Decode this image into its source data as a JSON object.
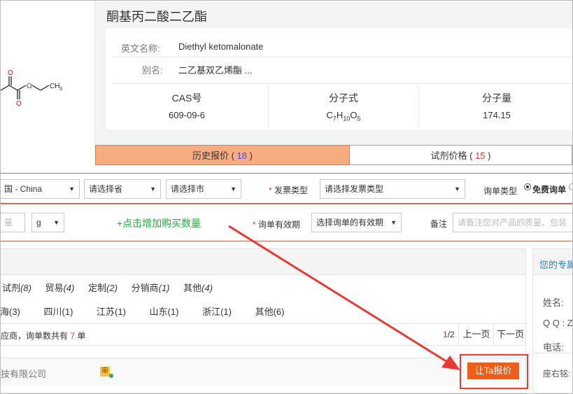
{
  "structure": {
    "o_top": "O",
    "o_mid": "O",
    "o_bottom": "O",
    "ch3": "CH",
    "ch3_sub": "3"
  },
  "compound": {
    "name_cn": "酮基丙二酸二乙酯",
    "english_label": "英文名称:",
    "english_name": "Diethyl ketomalonate",
    "alias_label": "别名:",
    "alias": "二乙基双乙烯酯 ...",
    "cas_label": "CAS号",
    "cas": "609-09-6",
    "formula_label": "分子式",
    "formula": {
      "c": "C",
      "c_n": "7",
      "h": "H",
      "h_n": "10",
      "o": "O",
      "o_n": "5"
    },
    "mw_label": "分子量",
    "mw": "174.15"
  },
  "tabs": [
    {
      "label": "历史报价",
      "count": "18"
    },
    {
      "label": "试剂价格",
      "count": "15"
    }
  ],
  "tab_paren_open": "(",
  "tab_paren_close": ")",
  "filters_row1": {
    "country": "国 - China",
    "province": "请选择省",
    "city": "请选择市",
    "invoice_label": "发票类型",
    "invoice_select": "请选择发票类型",
    "inquiry_type_label": "询单类型",
    "inquiry_type_option": "免费询单"
  },
  "filters_row2": {
    "quantity_placeholder": "量",
    "unit": "g",
    "add_quantity_link": "+点击增加购买数量",
    "validity_label": "询单有效期",
    "validity_select": "选择询单的有效期",
    "remark_label": "备注",
    "remark_placeholder": "请备注您对产品的质量、包装"
  },
  "arrow_dropdown": "▼",
  "required_mark": "*",
  "categories": [
    {
      "label": "试剂",
      "count": "(8)"
    },
    {
      "label": "贸易",
      "count": "(4)"
    },
    {
      "label": "定制",
      "count": "(2)"
    },
    {
      "label": "分销商",
      "count": "(1)"
    },
    {
      "label": "其他",
      "count": "(4)"
    }
  ],
  "regions": [
    "海(3)",
    "四川(1)",
    "江苏(1)",
    "山东(1)",
    "浙江(1)",
    "其他(6)"
  ],
  "summary": {
    "prefix": "应商，询单数共有",
    "count": "7",
    "suffix": "单"
  },
  "pagination": {
    "current": "1",
    "total": "/2",
    "prev": "上一页",
    "next": "下一页"
  },
  "supplier": {
    "name": "技有限公司",
    "badge": "审",
    "quote_button": "让Ta报价"
  },
  "sidebar": {
    "title": "您的专属",
    "name_label": "姓名:",
    "qq_label": "Q Q : Z",
    "phone_label": "电话:",
    "motto_label": "座右铭:"
  },
  "colors": {
    "tab_active": "#f7ab80",
    "accent_red": "#e23a2a",
    "link_green": "#27a844",
    "button_orange": "#f05d18"
  }
}
